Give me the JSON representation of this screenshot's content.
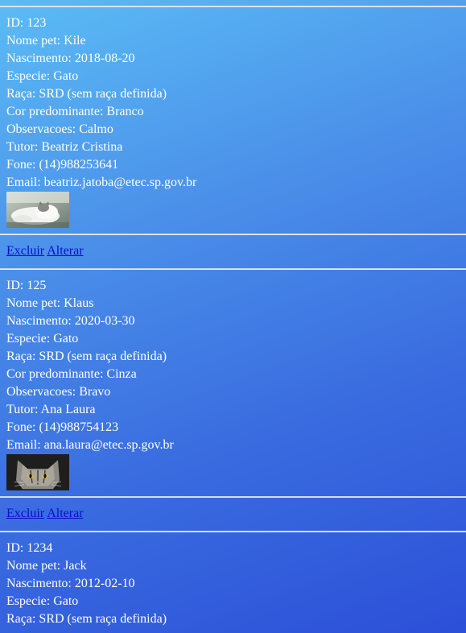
{
  "pets": [
    {
      "id": "ID: 123",
      "nome": "Nome pet: Kile",
      "nascimento": "Nascimento: 2018-08-20",
      "especie": "Especie: Gato",
      "raca": "Raça: SRD (sem raça definida)",
      "cor": "Cor predominante: Branco",
      "observacoes": "Observacoes: Calmo",
      "tutor": "Tutor: Beatriz Cristina",
      "fone": "Fone: (14)988253641",
      "email": "Email: beatriz.jatoba@etec.sp.gov.br",
      "photo": "cat-photo-lying"
    },
    {
      "id": "ID: 125",
      "nome": "Nome pet: Klaus",
      "nascimento": "Nascimento: 2020-03-30",
      "especie": "Especie: Gato",
      "raca": "Raça: SRD (sem raça definida)",
      "cor": "Cor predominante: Cinza",
      "observacoes": "Observacoes: Bravo",
      "tutor": "Tutor: Ana Laura",
      "fone": "Fone: (14)988754123",
      "email": "Email: ana.laura@etec.sp.gov.br",
      "photo": "cat-photo-face"
    },
    {
      "id": "ID: 1234",
      "nome": "Nome pet: Jack",
      "nascimento": "Nascimento: 2012-02-10",
      "especie": "Especie: Gato",
      "raca": "Raça: SRD (sem raça definida)"
    }
  ],
  "actions": {
    "delete_label": "Excluir",
    "edit_label": "Alterar"
  }
}
